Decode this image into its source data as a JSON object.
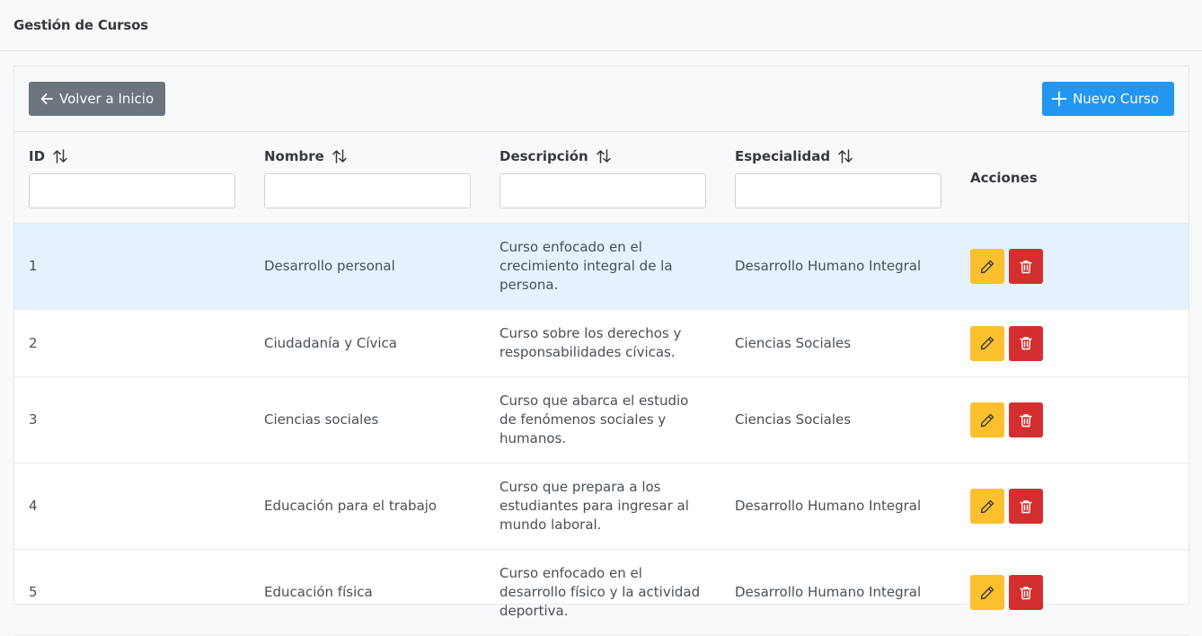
{
  "header": {
    "title": "Gestión de Cursos"
  },
  "toolbar": {
    "back_label": "Volver a Inicio",
    "new_label": "Nuevo Curso"
  },
  "columns": [
    {
      "label": "ID",
      "sortable": true,
      "filter_value": ""
    },
    {
      "label": "Nombre",
      "sortable": true,
      "filter_value": ""
    },
    {
      "label": "Descripción",
      "sortable": true,
      "filter_value": ""
    },
    {
      "label": "Especialidad",
      "sortable": true,
      "filter_value": ""
    },
    {
      "label": "Acciones",
      "sortable": false
    }
  ],
  "rows": [
    {
      "id": "1",
      "nombre": "Desarrollo personal",
      "descripcion": "Curso enfocado en el crecimiento integral de la persona.",
      "especialidad": "Desarrollo Humano Integral",
      "selected": true
    },
    {
      "id": "2",
      "nombre": "Ciudadanía y Cívica",
      "descripcion": "Curso sobre los derechos y responsabilidades cívicas.",
      "especialidad": "Ciencias Sociales",
      "selected": false
    },
    {
      "id": "3",
      "nombre": "Ciencias sociales",
      "descripcion": "Curso que abarca el estudio de fenómenos sociales y humanos.",
      "especialidad": "Ciencias Sociales",
      "selected": false
    },
    {
      "id": "4",
      "nombre": "Educación para el trabajo",
      "descripcion": "Curso que prepara a los estudiantes para ingresar al mundo laboral.",
      "especialidad": "Desarrollo Humano Integral",
      "selected": false
    },
    {
      "id": "5",
      "nombre": "Educación física",
      "descripcion": "Curso enfocado en el desarrollo físico y la actividad deportiva.",
      "especialidad": "Desarrollo Humano Integral",
      "selected": false
    }
  ],
  "icons": {
    "back": "arrow-left-icon",
    "new": "plus-icon",
    "sort": "sort-icon",
    "edit": "pencil-icon",
    "delete": "trash-icon"
  },
  "colors": {
    "primary": "#2196f3",
    "secondary": "#6c757d",
    "edit": "#fbc02d",
    "delete": "#d32f2f",
    "selected_row": "#e3f2fd"
  }
}
